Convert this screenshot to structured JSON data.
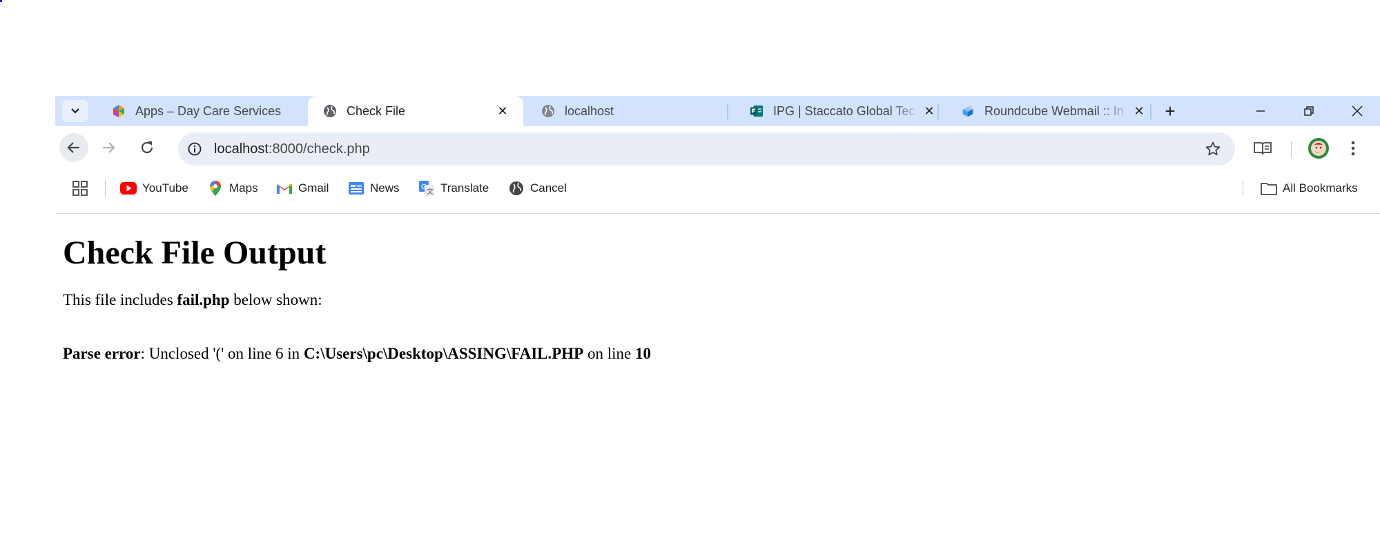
{
  "browser": {
    "tabs": [
      {
        "title": "Apps – Day Care Services",
        "icon": "colorful-apps-icon",
        "active": false
      },
      {
        "title": "Check File",
        "icon": "globe-icon",
        "active": true
      },
      {
        "title": "localhost",
        "icon": "globe-icon",
        "active": false
      },
      {
        "title": "IPG | Staccato Global Tec",
        "icon": "forms-icon",
        "active": false
      },
      {
        "title": "Roundcube Webmail :: In",
        "icon": "roundcube-icon",
        "active": false
      }
    ],
    "new_tab_label": "+",
    "address": {
      "host": "localhost",
      "path": ":8000/check.php"
    },
    "bookmarks": [
      {
        "label": "YouTube",
        "icon": "youtube-icon"
      },
      {
        "label": "Maps",
        "icon": "maps-icon"
      },
      {
        "label": "Gmail",
        "icon": "gmail-icon"
      },
      {
        "label": "News",
        "icon": "news-icon"
      },
      {
        "label": "Translate",
        "icon": "translate-icon"
      },
      {
        "label": "Cancel",
        "icon": "globe-icon"
      }
    ],
    "all_bookmarks_label": "All Bookmarks",
    "colors": {
      "tabstrip": "#d3e3fd",
      "omnibox": "#e9eef6",
      "tab_separator": "#a8c7fa"
    }
  },
  "page": {
    "heading": "Check File Output",
    "intro": {
      "before": "This file includes ",
      "filename": "fail.php",
      "after": " below shown:"
    },
    "error": {
      "label": "Parse error",
      "message": ": Unclosed '(' on line 6 in ",
      "path": "C:\\Users\\pc\\Desktop\\ASSING\\FAIL.PHP",
      "on_line": " on line ",
      "line": "10"
    }
  }
}
